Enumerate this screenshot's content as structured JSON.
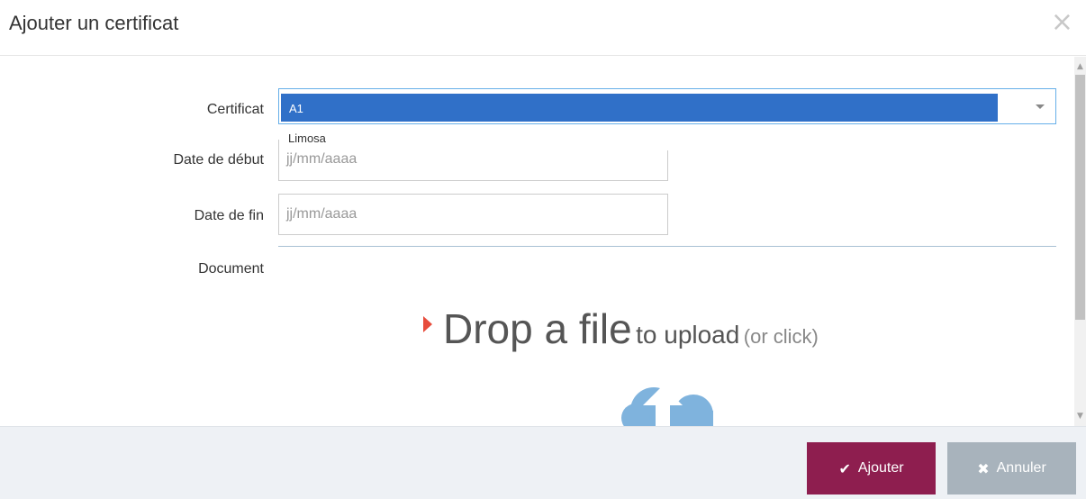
{
  "modal": {
    "title": "Ajouter un certificat",
    "close_icon": "×"
  },
  "form": {
    "certificat_label": "Certificat",
    "certificat_selected": "A1",
    "certificat_option": "Limosa",
    "date_debut_label": "Date de début",
    "date_debut_placeholder": "jj/mm/aaaa",
    "date_fin_label": "Date de fin",
    "date_fin_placeholder": "jj/mm/aaaa",
    "document_label": "Document"
  },
  "dropzone": {
    "main_text": "Drop a file",
    "sub_text": "to upload",
    "click_text": "(or click)"
  },
  "footer": {
    "add_icon": "✔",
    "add_label": "Ajouter",
    "cancel_icon": "✖",
    "cancel_label": "Annuler"
  },
  "colors": {
    "accent": "#8e1e4f",
    "select_highlight": "#3070c8",
    "drop_arrow": "#e74c3c",
    "cloud": "#7fb3dd"
  }
}
